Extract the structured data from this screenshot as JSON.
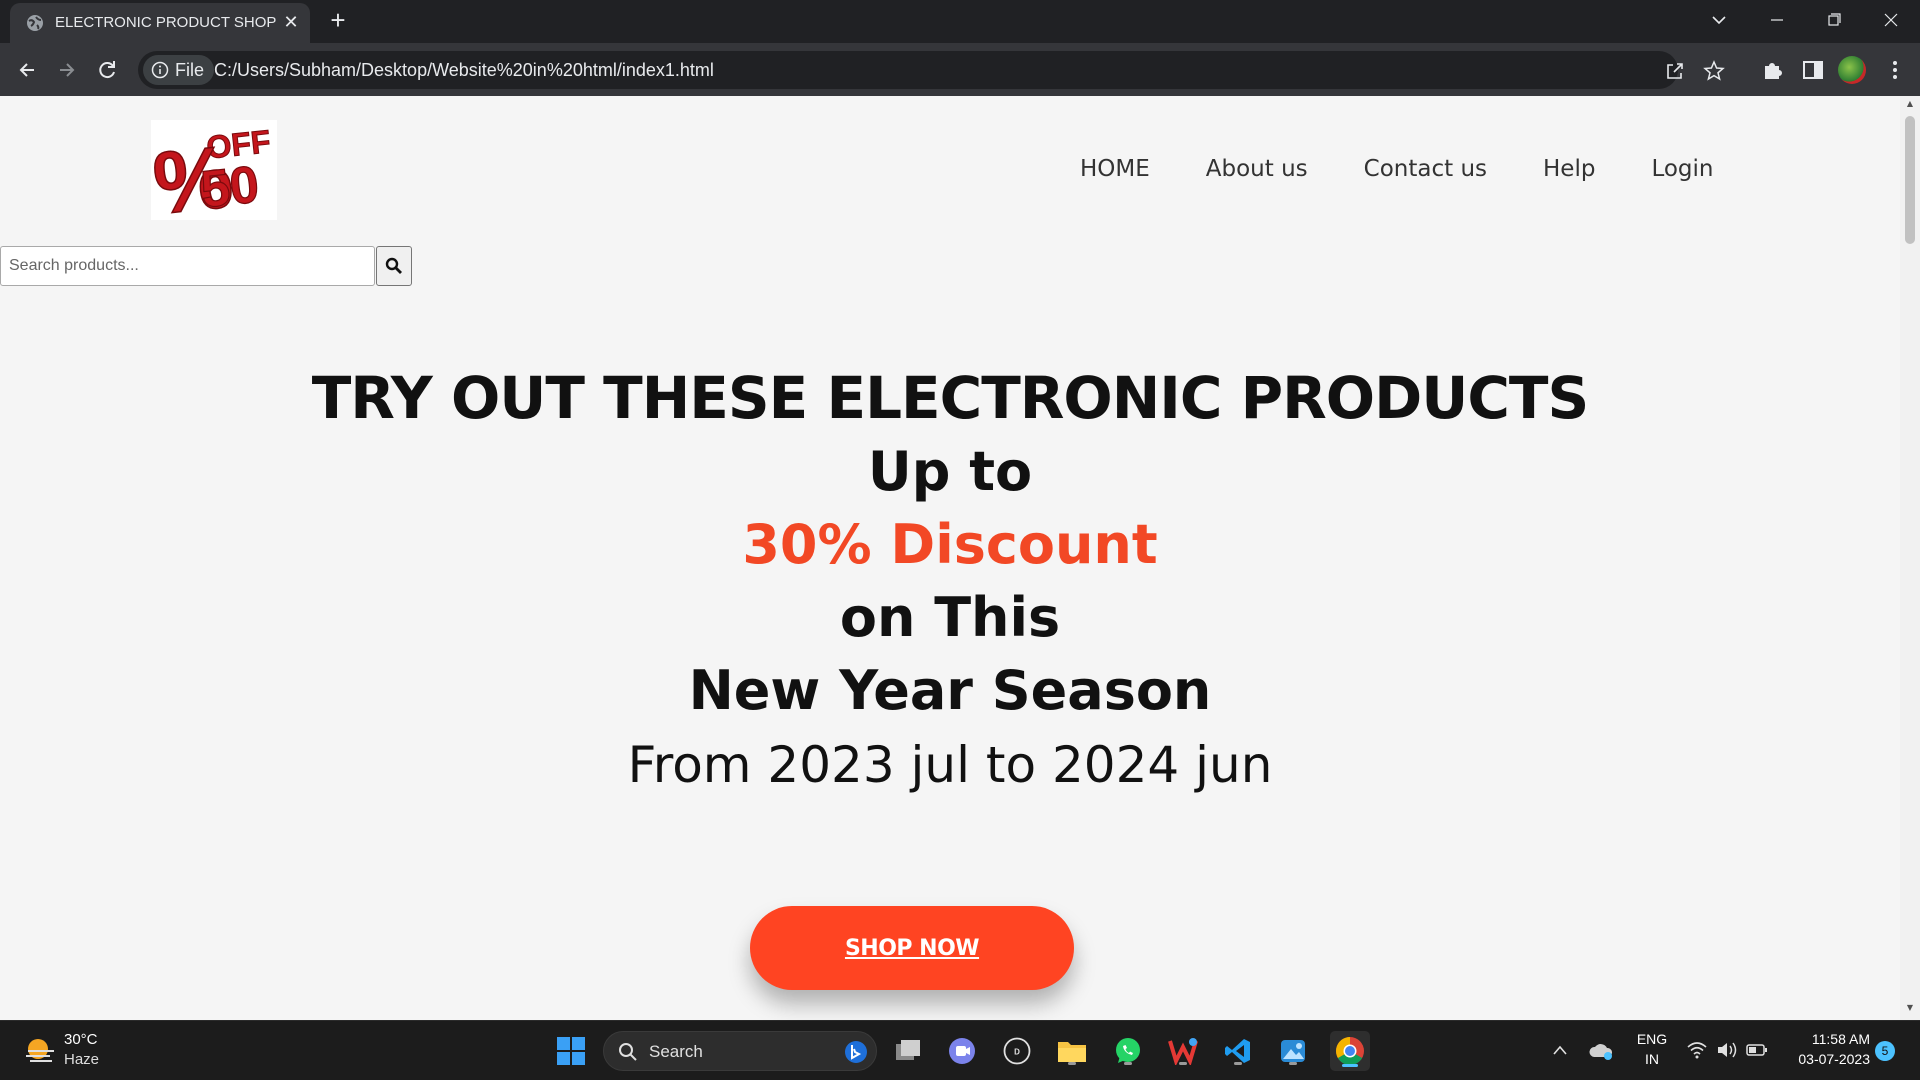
{
  "browser": {
    "tab_title": "ELECTRONIC PRODUCT SHOP",
    "tab_close": "✕",
    "new_tab": "+",
    "security_chip": "File",
    "url": "C:/Users/Subham/Desktop/Website%20in%20html/index1.html"
  },
  "page": {
    "logo": {
      "top_text": "OFF",
      "percent": "%",
      "number": "50",
      "colors": {
        "primary": "#c4161c"
      }
    },
    "nav": [
      {
        "label": "HOME"
      },
      {
        "label": "About us"
      },
      {
        "label": "Contact us"
      },
      {
        "label": "Help"
      },
      {
        "label": "Login"
      }
    ],
    "search": {
      "placeholder": "Search products...",
      "value": ""
    },
    "hero": {
      "title": "TRY OUT THESE ELECTRONIC PRODUCTS",
      "line1": "Up to",
      "line2": "30% Discount",
      "line3": "on This",
      "line4": "New Year Season",
      "line5": "From 2023 jul to 2024 jun"
    },
    "cta": {
      "label": "SHOP NOW"
    },
    "colors": {
      "accent": "#f24825",
      "button": "#ff4422",
      "background": "#f5f5f5"
    }
  },
  "taskbar": {
    "weather": {
      "temp": "30°C",
      "desc": "Haze"
    },
    "search_label": "Search",
    "apps": [
      "windows-start",
      "bing",
      "task-view",
      "teams",
      "dell",
      "file-explorer",
      "whatsapp",
      "wps-office",
      "vscode",
      "photos",
      "chrome"
    ],
    "language": {
      "line1": "ENG",
      "line2": "IN"
    },
    "clock": {
      "time": "11:58 AM",
      "date": "03-07-2023"
    },
    "notifications": "5"
  }
}
